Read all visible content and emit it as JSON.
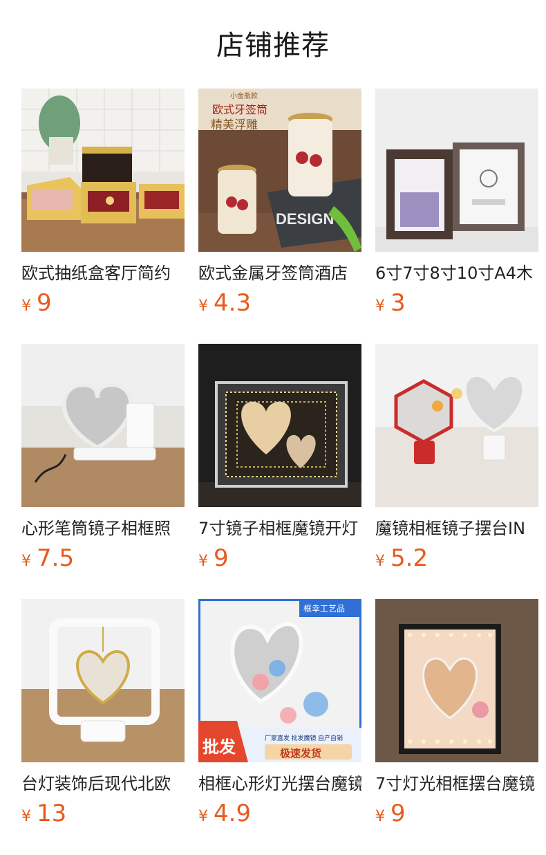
{
  "header": {
    "title": "店铺推荐"
  },
  "products": [
    {
      "title": "欧式抽纸盒客厅简约",
      "currency": "¥",
      "price": "9",
      "image": "gold-tissue-box"
    },
    {
      "title": "欧式金属牙签筒酒店",
      "currency": "¥",
      "price": "4.3",
      "image": "toothpick-holder",
      "image_text": {
        "tag": "小金瓶款",
        "title": "欧式牙签筒",
        "subtitle": "精美浮雕",
        "book": "DESIGN"
      }
    },
    {
      "title": "6寸7寸8寸10寸A4木",
      "currency": "¥",
      "price": "3",
      "image": "wooden-photo-frames"
    },
    {
      "title": "心形笔筒镜子相框照",
      "currency": "¥",
      "price": "7.5",
      "image": "heart-mirror-pen-holder"
    },
    {
      "title": "7寸镜子相框魔镜开灯",
      "currency": "¥",
      "price": "9",
      "image": "infinity-mirror-frame"
    },
    {
      "title": "魔镜相框镜子摆台IN",
      "currency": "¥",
      "price": "5.2",
      "image": "magic-mirror-stands"
    },
    {
      "title": "台灯装饰后现代北欧",
      "currency": "¥",
      "price": "13",
      "image": "heart-lamp"
    },
    {
      "title": "相框心形灯光摆台魔镜",
      "currency": "¥",
      "price": "4.9",
      "image": "heart-light-stand",
      "image_text": {
        "brand": "框幸工艺品",
        "badge": "批发",
        "line": "厂家直发 批发魔镜 自产自销",
        "cta": "极速发货"
      }
    },
    {
      "title": "7寸灯光相框摆台魔镜",
      "currency": "¥",
      "price": "9",
      "image": "lit-photo-frame"
    }
  ]
}
